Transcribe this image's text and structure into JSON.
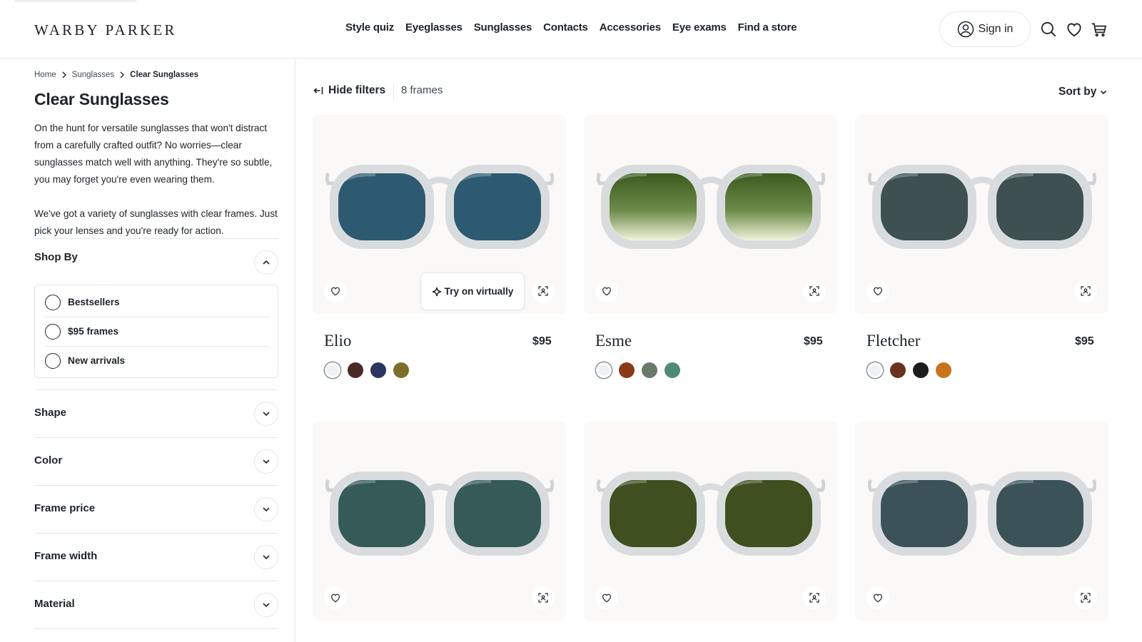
{
  "header": {
    "brand": "WARBY PARKER",
    "nav": [
      "Style quiz",
      "Eyeglasses",
      "Sunglasses",
      "Contacts",
      "Accessories",
      "Eye exams",
      "Find a store"
    ],
    "sign_in": "Sign in",
    "icons": [
      "user-icon",
      "search-icon",
      "heart-icon",
      "cart-icon"
    ]
  },
  "breadcrumb": [
    "Home",
    "Sunglasses",
    "Clear Sunglasses"
  ],
  "page": {
    "title": "Clear Sunglasses",
    "description": [
      "On the hunt for versatile sunglasses that won't distract from a carefully crafted outfit? No worries—clear sunglasses match well with anything. They're so subtle, you may forget you're even wearing them.",
      "We've got a variety of sunglasses with clear frames. Just pick your lenses and you're ready for action."
    ]
  },
  "filters": {
    "shop_by": {
      "title": "Shop By",
      "options": [
        "Bestsellers",
        "$95 frames",
        "New arrivals"
      ]
    },
    "sections": [
      "Shape",
      "Color",
      "Frame price",
      "Frame width",
      "Material"
    ]
  },
  "toolbar": {
    "hide_filters": "Hide filters",
    "count": "8 frames",
    "sort_by": "Sort by"
  },
  "try_on_label": "Try on virtually",
  "products": [
    {
      "name": "Elio",
      "price": "$95",
      "lens": "#2d5a70",
      "swatches": [
        "#eef0f1",
        "#4a2a26",
        "#2c3560",
        "#7a6e2a"
      ]
    },
    {
      "name": "Esme",
      "price": "$95",
      "lens": "gradient-green",
      "swatches": [
        "#eef0f1",
        "#8a3a18",
        "#6a7a6a",
        "#4f8a78"
      ]
    },
    {
      "name": "Fletcher",
      "price": "$95",
      "lens": "#3e5052",
      "swatches": [
        "#eef0f1",
        "#6a3320",
        "#1c1c1c",
        "#c8741a"
      ]
    },
    {
      "name": "",
      "price": "",
      "lens": "#355a58",
      "swatches": []
    },
    {
      "name": "",
      "price": "",
      "lens": "#3f4f1f",
      "swatches": []
    },
    {
      "name": "",
      "price": "",
      "lens": "#3b5258",
      "swatches": []
    }
  ]
}
